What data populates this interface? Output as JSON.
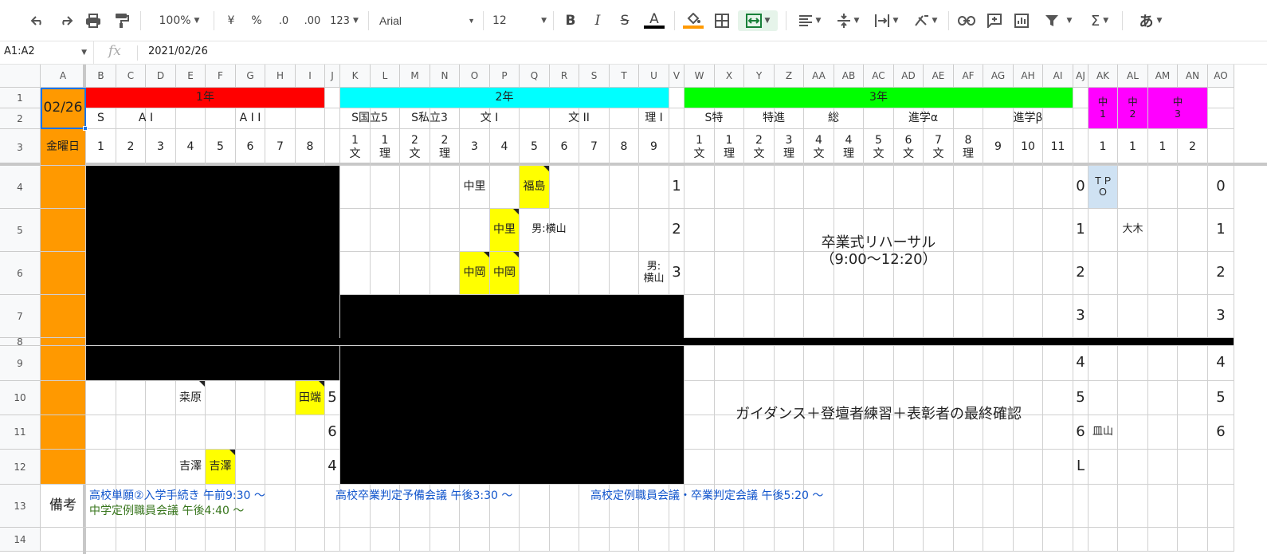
{
  "toolbar": {
    "zoom": "100%",
    "currency": "¥",
    "percent": "%",
    "dec_less": ".0",
    "dec_more": ".00",
    "format": "123",
    "font": "Arial",
    "font_size": "12",
    "bold": "B",
    "italic": "I",
    "strike": "S",
    "text_color": "A",
    "input_tool": "あ"
  },
  "formula_bar": {
    "range": "A1:A2",
    "fx": "fx",
    "value": "2021/02/26"
  },
  "columns": [
    "A",
    "B",
    "C",
    "D",
    "E",
    "F",
    "G",
    "H",
    "I",
    "J",
    "K",
    "L",
    "M",
    "N",
    "O",
    "P",
    "Q",
    "R",
    "S",
    "T",
    "U",
    "V",
    "W",
    "X",
    "Y",
    "Z",
    "AA",
    "AB",
    "AC",
    "AD",
    "AE",
    "AF",
    "AG",
    "AH",
    "AI",
    "AJ",
    "AK",
    "AL",
    "AM",
    "AN",
    "AO"
  ],
  "rows": [
    "1",
    "2",
    "3",
    "4",
    "5",
    "6",
    "7",
    "8",
    "9",
    "10",
    "11",
    "12",
    "13",
    "14"
  ],
  "header": {
    "date": "02/26",
    "weekday": "金曜日",
    "grade1": "1年",
    "grade2": "2年",
    "grade3": "3年",
    "jh1": "中\n1",
    "jh2": "中\n2",
    "jh3": "中\n3",
    "groups": [
      "S",
      "A I",
      "A I I",
      "S国立5",
      "S私立3",
      "文 I",
      "文 II",
      "理 I",
      "S特",
      "特進",
      "総",
      "進学α",
      "進学β"
    ],
    "classes": [
      "1",
      "2",
      "3",
      "4",
      "5",
      "6",
      "7",
      "8",
      "1\n文",
      "1\n理",
      "2\n文",
      "2\n理",
      "3",
      "4",
      "5",
      "6",
      "7",
      "8",
      "9",
      "1\n文",
      "1\n理",
      "2\n文",
      "3\n理",
      "4\n文",
      "4\n理",
      "5\n文",
      "6\n文",
      "7\n文",
      "8\n理",
      "9",
      "10",
      "11",
      "1",
      "1",
      "1",
      "2"
    ]
  },
  "cells": {
    "o4": "中里",
    "q4": "福島",
    "p5": "中里",
    "q5": "男:横山",
    "o6": "中岡",
    "p6": "中岡",
    "u6": "男:\n横山",
    "e10": "桒原",
    "i10": "田端",
    "e12": "吉澤",
    "f12": "吉澤",
    "ak4": "ＴＰ\nＯ",
    "al5": "大木",
    "ak11": "皿山"
  },
  "periods": {
    "v": [
      "1",
      "2",
      "3"
    ],
    "j": [
      "5",
      "6",
      "4"
    ],
    "aj": [
      "0",
      "1",
      "2",
      "3",
      "4",
      "5",
      "6",
      "L"
    ],
    "ao": [
      "0",
      "1",
      "2",
      "3",
      "4",
      "5",
      "6"
    ]
  },
  "events": {
    "rehearsal": "卒業式リハーサル\n（9:00～12:20）",
    "guidance": "ガイダンス＋登壇者練習＋表彰者の最終確認"
  },
  "remarks": {
    "label": "備考",
    "note1": "高校単願②入学手続き 午前9:30 ～",
    "note2": "高校卒業判定予備会議 午後3:30 ～",
    "note3": "高校定例職員会議・卒業判定会議 午後5:20 ～",
    "note4": "中学定例職員会議 午後4:40 ～"
  },
  "colors": {
    "orange": "#ff9900",
    "red": "#ff0000",
    "cyan": "#00ffff",
    "green": "#00ff00",
    "magenta": "#ff00ff",
    "yellow": "#ffff00",
    "tpo_blue": "#cfe2f3",
    "note_blue": "#1155cc",
    "note_green": "#38761d"
  }
}
